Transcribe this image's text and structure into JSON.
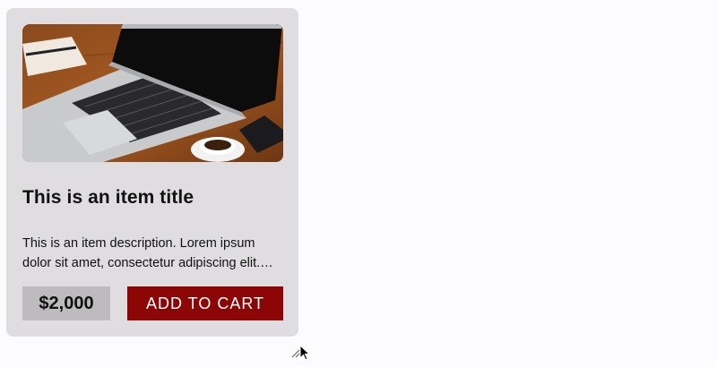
{
  "card": {
    "image_alt": "laptop-on-desk-photo",
    "title": "This is an item title",
    "description": "This is an item description. Lorem ipsum dolor sit amet, consectetur adipiscing elit. Sed do eiusmod tempor.",
    "price": "$2,000",
    "add_to_cart_label": "ADD TO CART"
  },
  "colors": {
    "page_background": "#fcfbfd",
    "card_background": "#dfdde0",
    "price_background": "#bdbbbe",
    "button_background": "#8c0605",
    "button_text": "#ffffff"
  },
  "icons": {
    "resize": "resize-grip-icon",
    "cursor": "mouse-pointer-icon"
  }
}
